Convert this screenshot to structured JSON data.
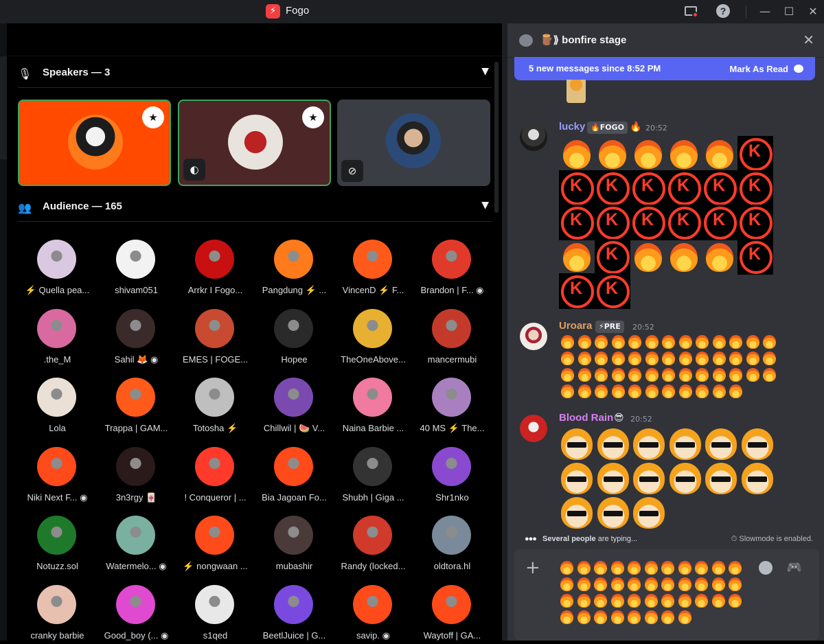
{
  "window": {
    "title": "Fogo",
    "logo_glyph": "⚡"
  },
  "stage": {
    "speakers": {
      "label": "Speakers — 3"
    },
    "audience": {
      "label": "Audience — 165"
    },
    "audience_members": [
      "⚡ Quella pea...",
      "shivam051",
      "Arrkr I Fogo...",
      "Pangdung ⚡ ...",
      "VincenD ⚡ F...",
      "Brandon | F... ◉",
      ".the_M",
      "Sahil 🦊 ◉",
      "EMES | FOGE...",
      "Hopee",
      "TheOneAbove...",
      "mancermubi",
      "Lola",
      "Trappa | GAM...",
      "Totosha ⚡",
      "Chillwil | 🍉 V...",
      "Naina Barbie ...",
      "40 MS ⚡ The...",
      "Niki Next F... ◉",
      "3n3rgy 🀄",
      "! Conqueror | ...",
      "Bia Jagoan Fo...",
      "Shubh | Giga ...",
      "Shr1nko",
      "Notuzz.sol",
      "Watermelo... ◉",
      "⚡ nongwaan ...",
      "mubashir",
      "Randy (locked...",
      "oldtora.hl",
      "cranky barbie",
      "Good_boy (... ◉",
      "s1qed",
      "BeetlJuice | G...",
      "savip. ◉",
      "Waytoff | GA..."
    ]
  },
  "chat": {
    "title": "🪵⟫ bonfire stage",
    "new_messages": "5 new messages since 8:52 PM",
    "mark_as_read": "Mark As Read",
    "messages": [
      {
        "author": "lucky",
        "tag": "🔥FOGO",
        "extra": "🔥",
        "time": "20:52",
        "color": "#9b9cf7"
      },
      {
        "author": "Uroara",
        "tag": "⚡PRE",
        "time": "20:52",
        "color": "#e0a060"
      },
      {
        "author": "Blood Rain",
        "extra": "😎",
        "time": "20:52",
        "color": "#d580f0"
      }
    ],
    "typing": "Several people are typing...",
    "typing_who": "Several people",
    "typing_rest": " are typing...",
    "slowmode": "Slowmode is enabled."
  }
}
